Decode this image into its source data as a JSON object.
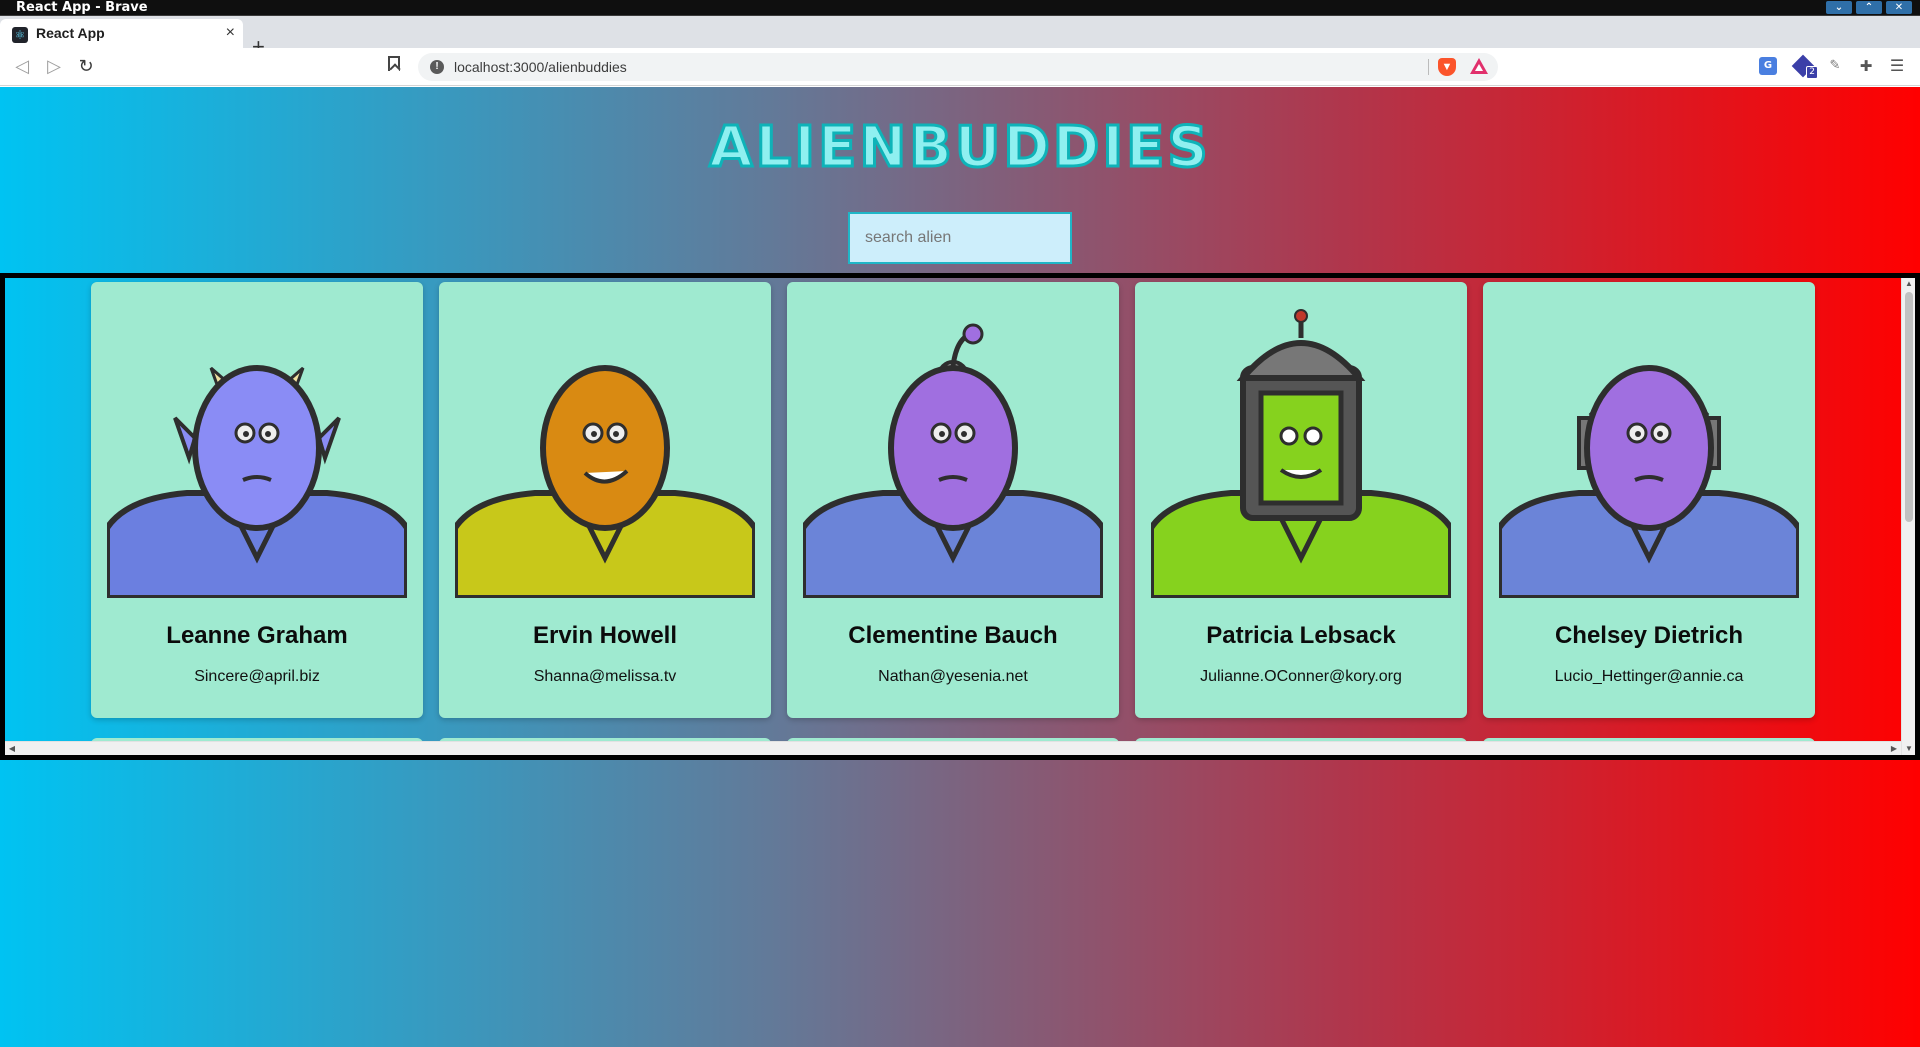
{
  "window": {
    "title": "React App - Brave"
  },
  "tab": {
    "title": "React App",
    "close_glyph": "×",
    "favicon": "react-icon"
  },
  "toolbar": {
    "back_glyph": "◁",
    "forward_glyph": "▷",
    "reload_glyph": "↻",
    "url": "localhost:3000/alienbuddies",
    "info_glyph": "!",
    "extension_badge_count": "2"
  },
  "page": {
    "title": "ALIENBUDDIES",
    "title_color": "#0eb3b8",
    "search": {
      "placeholder": "search alien",
      "value": ""
    },
    "gradient_colors": [
      "#00c3f2",
      "#ff0000"
    ],
    "card_color": "#9fead0"
  },
  "aliens": [
    {
      "name": "Leanne Graham",
      "email": "Sincere@april.biz",
      "skin": "#8a8cf5",
      "suit": "#6b7fe0",
      "variant": "horned"
    },
    {
      "name": "Ervin Howell",
      "email": "Shanna@melissa.tv",
      "skin": "#d98a12",
      "suit": "#c8c81a",
      "variant": "grin"
    },
    {
      "name": "Clementine Bauch",
      "email": "Nathan@yesenia.net",
      "skin": "#a06fe0",
      "suit": "#6b84d8",
      "variant": "cyclops"
    },
    {
      "name": "Patricia Lebsack",
      "email": "Julianne.OConner@kory.org",
      "skin": "#86d21e",
      "suit": "#86d21e",
      "variant": "helmet"
    },
    {
      "name": "Chelsey Dietrich",
      "email": "Lucio_Hettinger@annie.ca",
      "skin": "#a06fe0",
      "suit": "#6b84d8",
      "variant": "robot"
    }
  ]
}
